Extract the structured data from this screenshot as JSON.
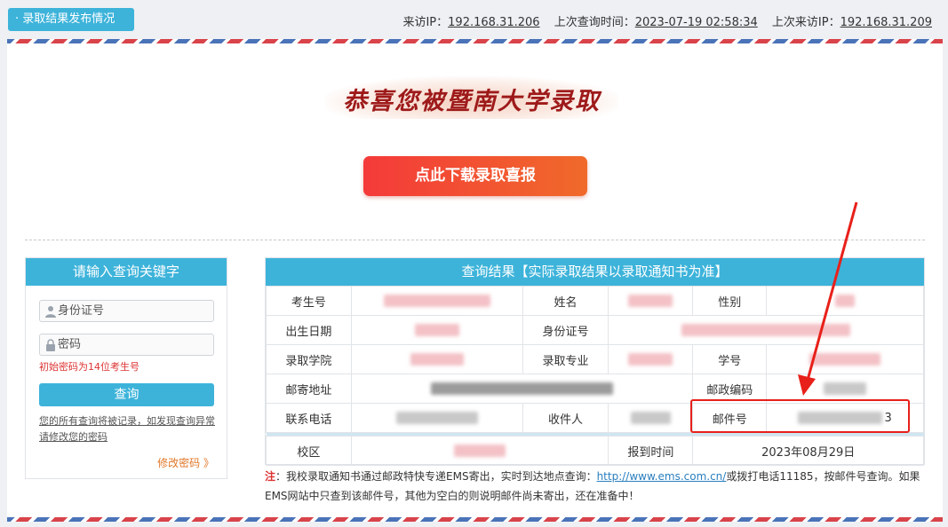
{
  "header": {
    "publish_tab": "· 录取结果发布情况",
    "visit_ip_label": "来访IP：",
    "visit_ip": "192.168.31.206",
    "last_query_label": "上次查询时间：",
    "last_query_time": "2023-07-19 02:58:34",
    "last_ip_label": "上次来访IP：",
    "last_ip": "192.168.31.209"
  },
  "banner": {
    "congrats_text": "恭喜您被暨南大学录取",
    "download_button": "点此下载录取喜报"
  },
  "query_panel": {
    "title": "请输入查询关键字",
    "id_placeholder": "身份证号",
    "password_placeholder": "密码",
    "password_hint": "初始密码为14位考生号",
    "query_button": "查询",
    "record_note": "您的所有查询将被记录，如发现查询异常请修改您的密码",
    "change_password": "修改密码 》"
  },
  "result_panel": {
    "title": "查询结果【实际录取结果以录取通知书为准】",
    "labels": {
      "exam_no": "考生号",
      "name": "姓名",
      "gender": "性别",
      "birth_date": "出生日期",
      "id_no": "身份证号",
      "college": "录取学院",
      "major": "录取专业",
      "student_no": "学号",
      "address": "邮寄地址",
      "postcode": "邮政编码",
      "phone": "联系电话",
      "recipient": "收件人",
      "mail_no": "邮件号",
      "campus": "校区",
      "report_time": "报到时间"
    },
    "values": {
      "mail_no_tail": "3",
      "report_date": "2023年08月29日"
    }
  },
  "footnote": {
    "label": "注",
    "text1": "：我校录取通知书通过邮政特快专递EMS寄出，实时到达地点查询：",
    "link": "http://www.ems.com.cn/",
    "text2": "或拨打电话11185，按邮件号查询。如果EMS网站中只查到该邮件号，其他为空白的则说明邮件尚未寄出，还在准备中！"
  },
  "colors": {
    "accent": "#3db3da",
    "download_start": "#f43a3a",
    "download_end": "#f06a2a",
    "highlight": "#e8201a",
    "warning_text": "#d33"
  }
}
